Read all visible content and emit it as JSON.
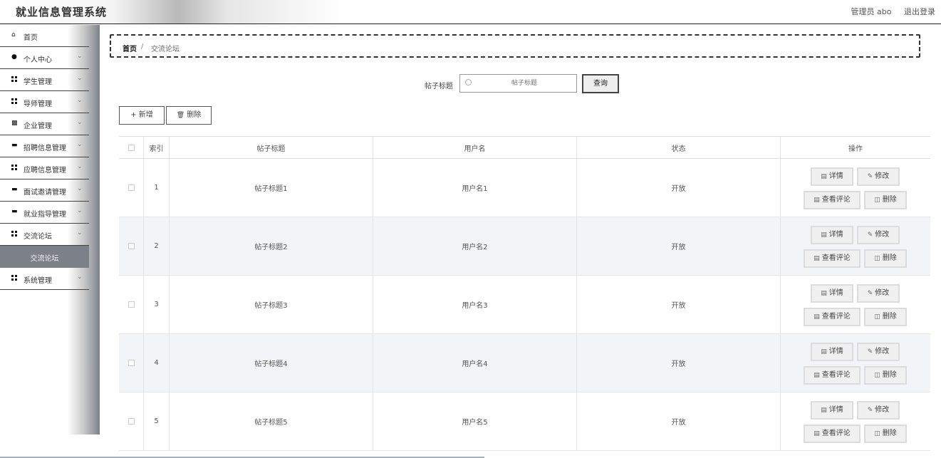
{
  "header": {
    "title": "就业信息管理系统",
    "user_label": "管理员 abo",
    "logout": "退出登录"
  },
  "sidebar": {
    "items": [
      {
        "label": "首页",
        "icon": "home-icon",
        "arrow": false
      },
      {
        "label": "个人中心",
        "icon": "user-icon",
        "arrow": true
      },
      {
        "label": "学生管理",
        "icon": "grid-icon",
        "arrow": true
      },
      {
        "label": "导师管理",
        "icon": "grid-icon",
        "arrow": true
      },
      {
        "label": "企业管理",
        "icon": "building-icon",
        "arrow": true
      },
      {
        "label": "招聘信息管理",
        "icon": "doc-icon",
        "arrow": true
      },
      {
        "label": "应聘信息管理",
        "icon": "grid-icon",
        "arrow": true
      },
      {
        "label": "面试邀请管理",
        "icon": "chat-icon",
        "arrow": true
      },
      {
        "label": "就业指导管理",
        "icon": "chat-icon",
        "arrow": true
      },
      {
        "label": "交流论坛",
        "icon": "grid-icon",
        "arrow": true
      }
    ],
    "active_sub": "交流论坛",
    "last_item": {
      "label": "系统管理",
      "icon": "grid-icon",
      "arrow": true
    }
  },
  "breadcrumb": {
    "home": "首页",
    "separator": "/",
    "current": "交流论坛"
  },
  "search": {
    "label": "帖子标题",
    "placeholder": "帖子标题",
    "button": "查询"
  },
  "toolbar": {
    "add": "+ 新增",
    "delete": "删除"
  },
  "table": {
    "headers": {
      "index": "索引",
      "title": "帖子标题",
      "user": "用户名",
      "status": "状态",
      "ops": "操作"
    },
    "op_labels": {
      "detail": "详情",
      "edit": "修改",
      "comments": "查看评论",
      "delete": "删除"
    },
    "rows": [
      {
        "index": "1",
        "title": "帖子标题1",
        "user": "用户名1",
        "status": "开放"
      },
      {
        "index": "2",
        "title": "帖子标题2",
        "user": "用户名2",
        "status": "开放"
      },
      {
        "index": "3",
        "title": "帖子标题3",
        "user": "用户名3",
        "status": "开放"
      },
      {
        "index": "4",
        "title": "帖子标题4",
        "user": "用户名4",
        "status": "开放"
      },
      {
        "index": "5",
        "title": "帖子标题5",
        "user": "用户名5",
        "status": "开放"
      }
    ]
  }
}
